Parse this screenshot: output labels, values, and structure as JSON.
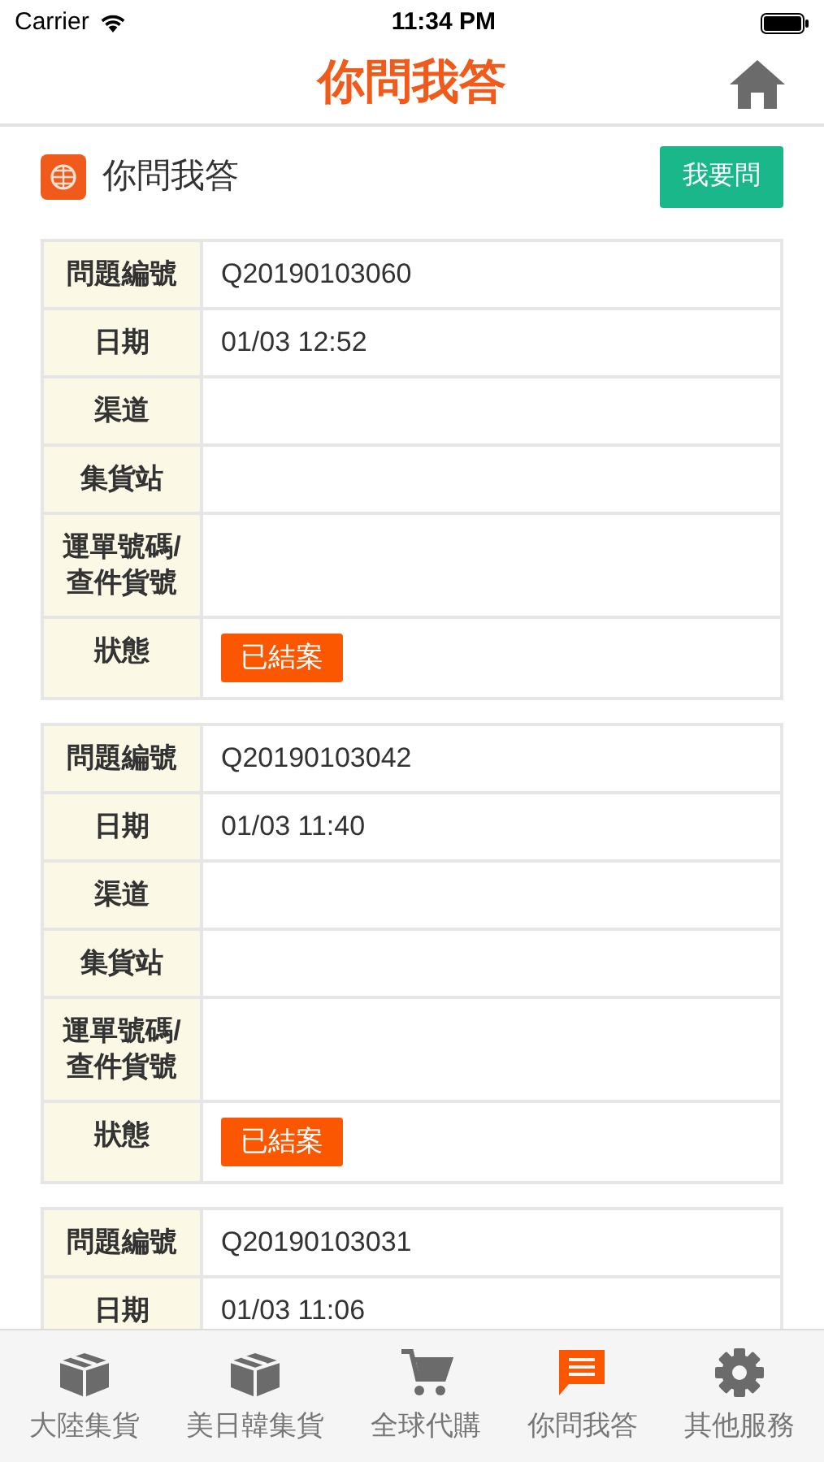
{
  "status_bar": {
    "carrier": "Carrier",
    "time": "11:34 PM"
  },
  "nav": {
    "title": "你問我答"
  },
  "section": {
    "title": "你問我答",
    "button": "我要問"
  },
  "cards": [
    {
      "rows": [
        {
          "kind": "text",
          "label": "問題編號",
          "value": "Q20190103060"
        },
        {
          "kind": "text",
          "label": "日期",
          "value": "01/03 12:52"
        },
        {
          "kind": "text",
          "label": "渠道"
        },
        {
          "kind": "text",
          "label": "集貨站"
        },
        {
          "kind": "text",
          "label": "運單號碼/\n查件貨號"
        },
        {
          "kind": "badge",
          "label": "狀態",
          "value": "已結案"
        }
      ]
    },
    {
      "rows": [
        {
          "kind": "text",
          "label": "問題編號",
          "value": "Q20190103042"
        },
        {
          "kind": "text",
          "label": "日期",
          "value": "01/03 11:40"
        },
        {
          "kind": "text",
          "label": "渠道"
        },
        {
          "kind": "text",
          "label": "集貨站"
        },
        {
          "kind": "text",
          "label": "運單號碼/\n查件貨號"
        },
        {
          "kind": "badge",
          "label": "狀態",
          "value": "已結案"
        }
      ]
    },
    {
      "rows": [
        {
          "kind": "text",
          "label": "問題編號",
          "value": "Q20190103031"
        },
        {
          "kind": "text",
          "label": "日期",
          "value": "01/03 11:06"
        }
      ]
    }
  ],
  "tab_bar": [
    {
      "kind": "box",
      "label": "大陸集貨",
      "selected": false
    },
    {
      "kind": "box",
      "label": "美日韓集貨",
      "selected": false
    },
    {
      "kind": "cart",
      "label": "全球代購",
      "selected": false
    },
    {
      "kind": "chat",
      "label": "你問我答",
      "selected": true
    },
    {
      "kind": "gear",
      "label": "其他服務",
      "selected": false
    }
  ]
}
